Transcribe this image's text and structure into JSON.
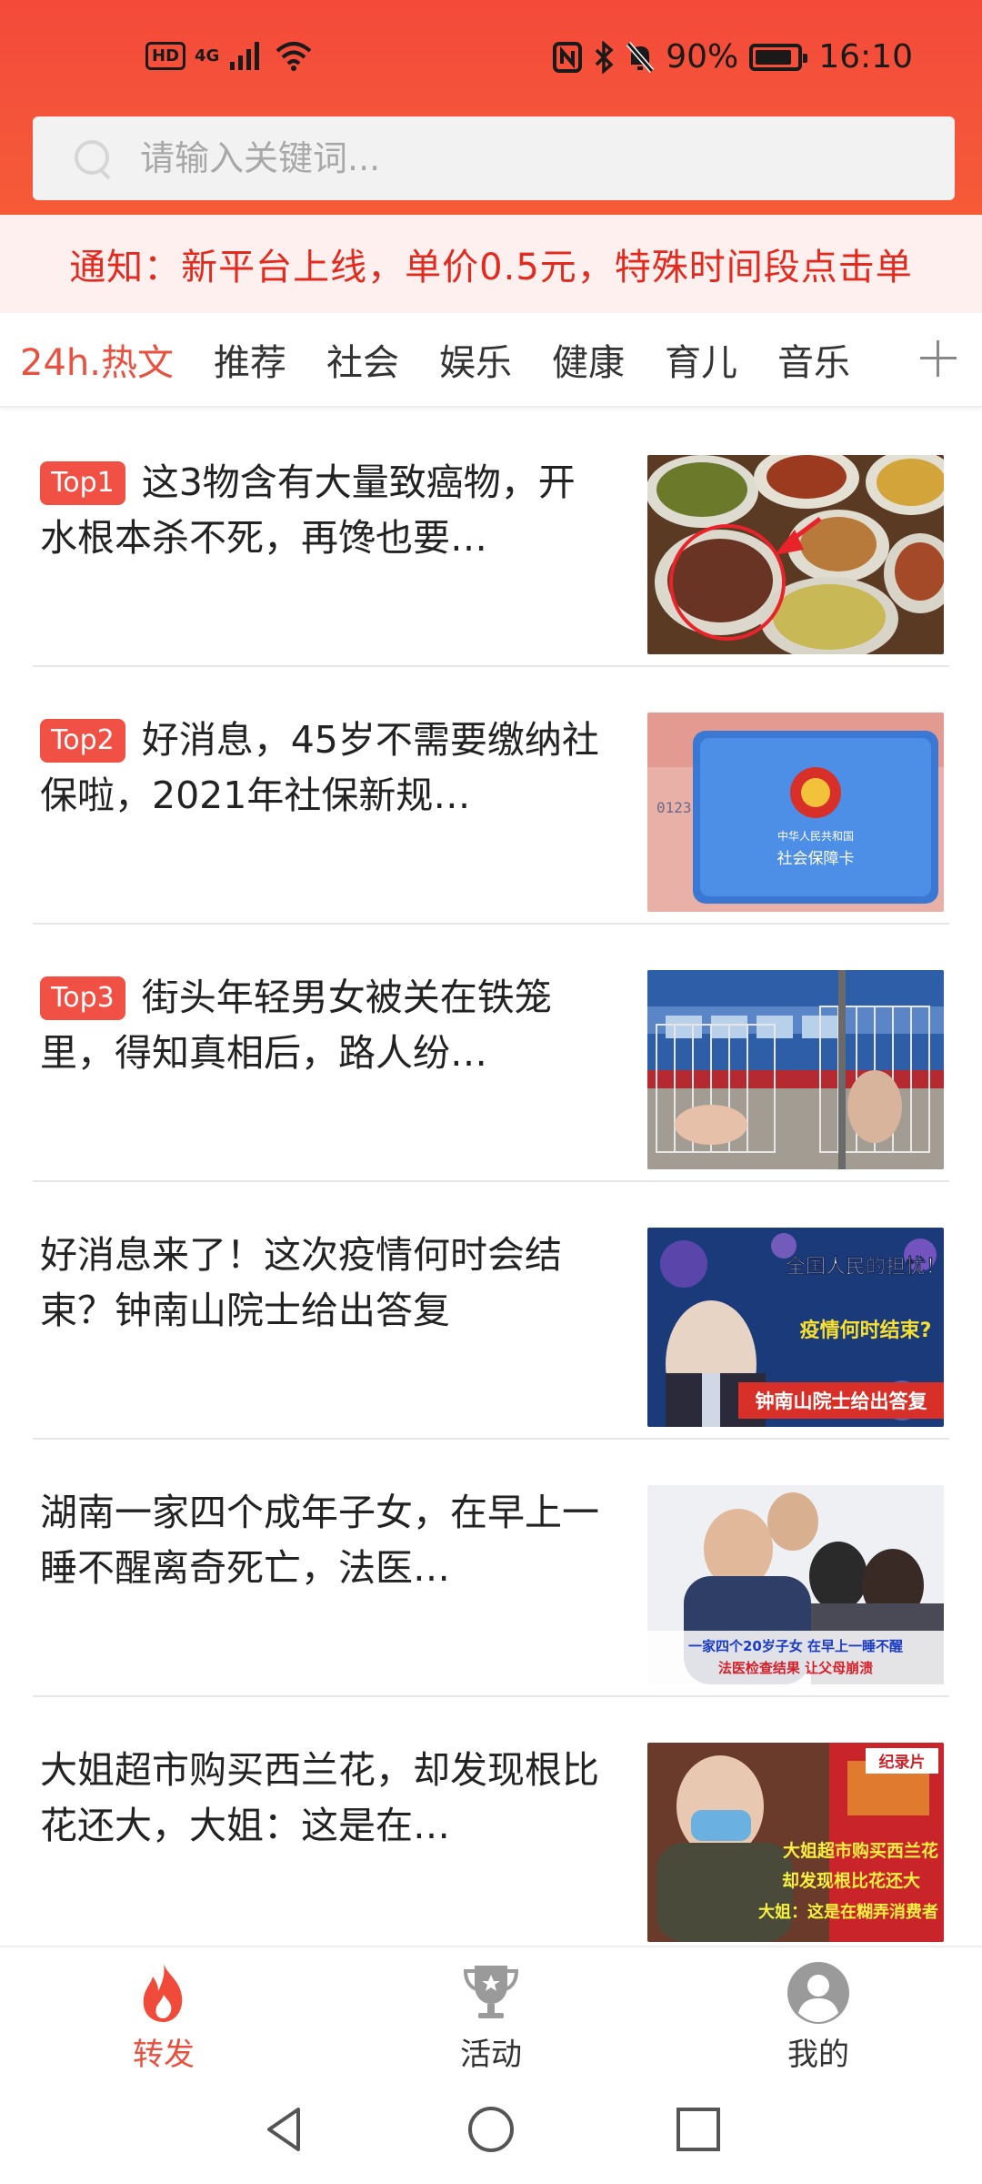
{
  "status_bar": {
    "hd": "HD",
    "network": "4G",
    "battery_pct": "90%",
    "time": "16:10"
  },
  "search": {
    "placeholder": "请输入关键词..."
  },
  "notice": {
    "text": "通知：新平台上线，单价0.5元，特殊时间段点击单"
  },
  "tabs": [
    {
      "label": "24h.热文",
      "active": true
    },
    {
      "label": "推荐"
    },
    {
      "label": "社会"
    },
    {
      "label": "娱乐"
    },
    {
      "label": "健康"
    },
    {
      "label": "育儿"
    },
    {
      "label": "音乐"
    }
  ],
  "articles": [
    {
      "badge": "Top1",
      "title": "这3物含有大量致癌物，开水根本杀不死，再馋也要…"
    },
    {
      "badge": "Top2",
      "title": "好消息，45岁不需要缴纳社保啦，2021年社保新规…"
    },
    {
      "badge": "Top3",
      "title": "街头年轻男女被关在铁笼里，得知真相后，路人纷…"
    },
    {
      "badge": "",
      "title": "好消息来了！这次疫情何时会结束？钟南山院士给出答复"
    },
    {
      "badge": "",
      "title": "湖南一家四个成年子女，在早上一睡不醒离奇死亡，法医…"
    },
    {
      "badge": "",
      "title": "大姐超市购买西兰花，却发现根比花还大，大姐：这是在…"
    }
  ],
  "thumbs": {
    "t2_card_line1": "中华人民共和国",
    "t2_card_line2": "社会保障卡",
    "t2_number": "0123",
    "t4_line1": "全国人民的担忧！",
    "t4_line2": "疫情何时结束?",
    "t4_line3": "钟南山院士给出答复",
    "t5_line1": "一家四个20岁子女 在早上一睡不醒",
    "t5_line2": "法医检查结果 让父母崩溃",
    "t6_tag": "纪录片",
    "t6_line1": "大姐超市购买西兰花",
    "t6_line2": "却发现根比花还大",
    "t6_line3": "大姐：这是在糊弄消费者"
  },
  "bottom_nav": [
    {
      "label": "转发",
      "icon": "fire-icon",
      "active": true
    },
    {
      "label": "活动",
      "icon": "trophy-icon"
    },
    {
      "label": "我的",
      "icon": "user-icon"
    }
  ],
  "colors": {
    "header": "#f44a3a",
    "accent": "#e8503f",
    "notice_text": "#e32a1f",
    "badge": "#f05144"
  }
}
